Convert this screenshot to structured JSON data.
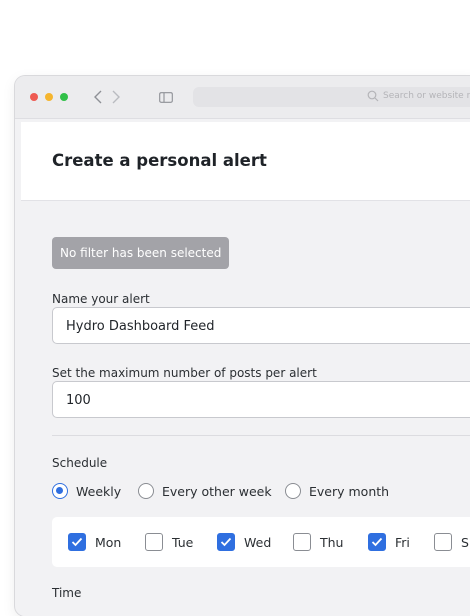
{
  "browser": {
    "url_placeholder": "Search or website name"
  },
  "page": {
    "title": "Create a personal alert",
    "filter_badge": "No filter has been selected",
    "name_field": {
      "label": "Name your alert",
      "value": "Hydro Dashboard Feed"
    },
    "max_posts_field": {
      "label": "Set the maximum number of posts per alert",
      "value": "100"
    },
    "schedule": {
      "label": "Schedule",
      "options": [
        "Weekly",
        "Every other week",
        "Every month"
      ],
      "selected": "Weekly"
    },
    "days": [
      {
        "label": "Mon",
        "checked": true
      },
      {
        "label": "Tue",
        "checked": false
      },
      {
        "label": "Wed",
        "checked": true
      },
      {
        "label": "Thu",
        "checked": false
      },
      {
        "label": "Fri",
        "checked": true
      },
      {
        "label": "S",
        "checked": false
      }
    ],
    "time_label": "Time"
  },
  "colors": {
    "accent": "#2f6fe0",
    "badge_bg": "#a3a3a8",
    "traffic_red": "#ee5a52",
    "traffic_yellow": "#f5b52e",
    "traffic_green": "#31c048"
  }
}
